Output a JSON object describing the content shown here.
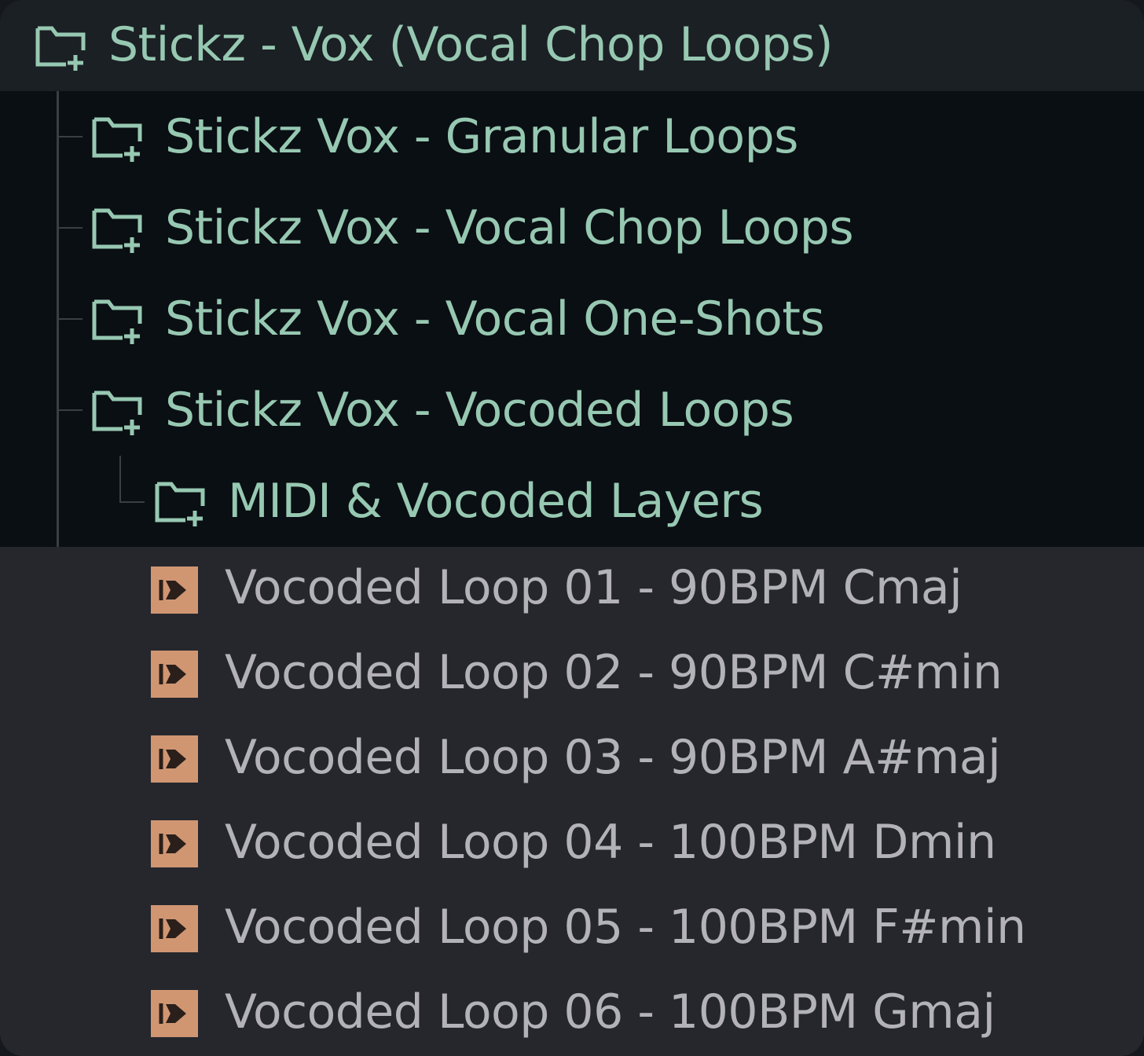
{
  "tree": {
    "root": {
      "label": "Stickz - Vox (Vocal Chop Loops)",
      "icon": "folder-add-icon"
    },
    "folders": [
      {
        "label": "Stickz Vox - Granular Loops",
        "icon": "folder-add-icon"
      },
      {
        "label": "Stickz Vox - Vocal Chop Loops",
        "icon": "folder-add-icon"
      },
      {
        "label": "Stickz Vox - Vocal One-Shots",
        "icon": "folder-add-icon"
      },
      {
        "label": "Stickz Vox - Vocoded Loops",
        "icon": "folder-add-icon"
      }
    ],
    "subfolder": {
      "label": "MIDI & Vocoded Layers",
      "icon": "folder-add-icon"
    },
    "files": [
      {
        "label": "Vocoded Loop 01 - 90BPM Cmaj",
        "icon": "midi-clip-icon"
      },
      {
        "label": "Vocoded Loop 02 - 90BPM C#min",
        "icon": "midi-clip-icon"
      },
      {
        "label": "Vocoded Loop 03 - 90BPM A#maj",
        "icon": "midi-clip-icon"
      },
      {
        "label": "Vocoded Loop 04 - 100BPM Dmin",
        "icon": "midi-clip-icon"
      },
      {
        "label": "Vocoded Loop 05 - 100BPM F#min",
        "icon": "midi-clip-icon"
      },
      {
        "label": "Vocoded Loop 06 - 100BPM Gmaj",
        "icon": "midi-clip-icon"
      }
    ]
  },
  "colors": {
    "folder_text": "#97c8b2",
    "file_text": "#b3b2b8",
    "file_icon_bg": "#d09672",
    "root_bg": "#1b2024",
    "folder_block_bg": "#0a0f13",
    "files_bg": "#26272d"
  }
}
